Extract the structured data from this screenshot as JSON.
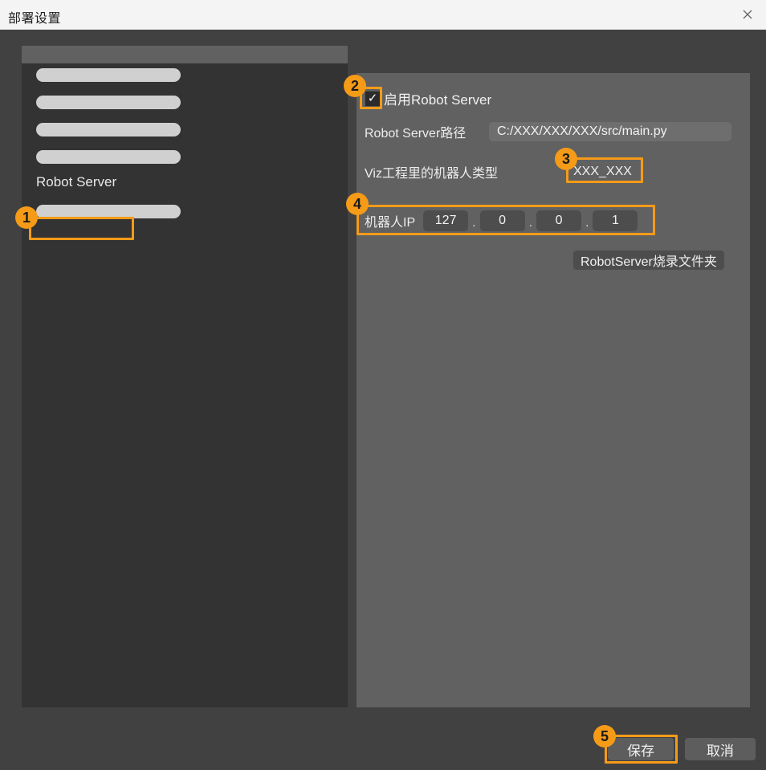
{
  "window": {
    "title": "部署设置",
    "close_icon": "close-icon"
  },
  "sidebar": {
    "items": [
      {
        "type": "placeholder",
        "label": ""
      },
      {
        "type": "placeholder",
        "label": ""
      },
      {
        "type": "placeholder",
        "label": ""
      },
      {
        "type": "placeholder",
        "label": ""
      },
      {
        "type": "text",
        "label": "Robot Server"
      },
      {
        "type": "placeholder",
        "label": ""
      }
    ],
    "selected": "Robot Server"
  },
  "form": {
    "enable": {
      "label": "启用Robot Server",
      "checked": true,
      "check_glyph": "✓"
    },
    "path": {
      "label": "Robot Server路径",
      "value": "C:/XXX/XXX/XXX/src/main.py"
    },
    "robot_type": {
      "label": "Viz工程里的机器人类型",
      "value": "XXX_XXX"
    },
    "ip": {
      "label": "机器人IP",
      "octets": [
        "127",
        "0",
        "0",
        "1"
      ],
      "separator": "."
    },
    "folder_button": {
      "label": "RobotServer烧录文件夹"
    }
  },
  "footer": {
    "save_label": "保存",
    "cancel_label": "取消"
  },
  "annotations": {
    "accent_color": "#f59b18",
    "steps": [
      {
        "id": "1",
        "target": "Robot Server"
      },
      {
        "id": "2",
        "target": "启用Robot Server checkbox"
      },
      {
        "id": "3",
        "target": "XXX_XXX"
      },
      {
        "id": "4",
        "target": "机器人IP"
      },
      {
        "id": "5",
        "target": "保存"
      }
    ]
  }
}
